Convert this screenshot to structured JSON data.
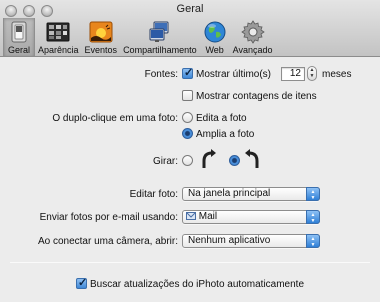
{
  "window": {
    "title": "Geral"
  },
  "toolbar": {
    "items": [
      {
        "label": "Geral",
        "icon": "switch-icon",
        "selected": true
      },
      {
        "label": "Aparência",
        "icon": "appearance-icon",
        "selected": false
      },
      {
        "label": "Eventos",
        "icon": "events-icon",
        "selected": false
      },
      {
        "label": "Compartilhamento",
        "icon": "sharing-icon",
        "selected": false
      },
      {
        "label": "Web",
        "icon": "web-globe-icon",
        "selected": false
      },
      {
        "label": "Avançado",
        "icon": "gear-icon",
        "selected": false
      }
    ]
  },
  "general": {
    "sources_label": "Fontes:",
    "show_last_label": "Mostrar último(s)",
    "show_last_checked": true,
    "months_value": "12",
    "months_unit": "meses",
    "show_counts_label": "Mostrar contagens de itens",
    "show_counts_checked": false,
    "double_click_label": "O duplo-clique em uma foto:",
    "double_click_options": [
      "Edita a foto",
      "Amplia a foto"
    ],
    "double_click_selected": 1,
    "rotate_label": "Girar:",
    "rotate_selected": "clockwise",
    "edit_photo_label": "Editar foto:",
    "edit_photo_value": "Na janela principal",
    "email_label": "Enviar fotos por e-mail usando:",
    "email_value": "Mail",
    "camera_label": "Ao conectar uma câmera, abrir:",
    "camera_value": "Nenhum aplicativo",
    "updates_label": "Buscar atualizações do iPhoto automaticamente",
    "updates_checked": true
  },
  "colors": {
    "accent": "#3f88d6"
  }
}
